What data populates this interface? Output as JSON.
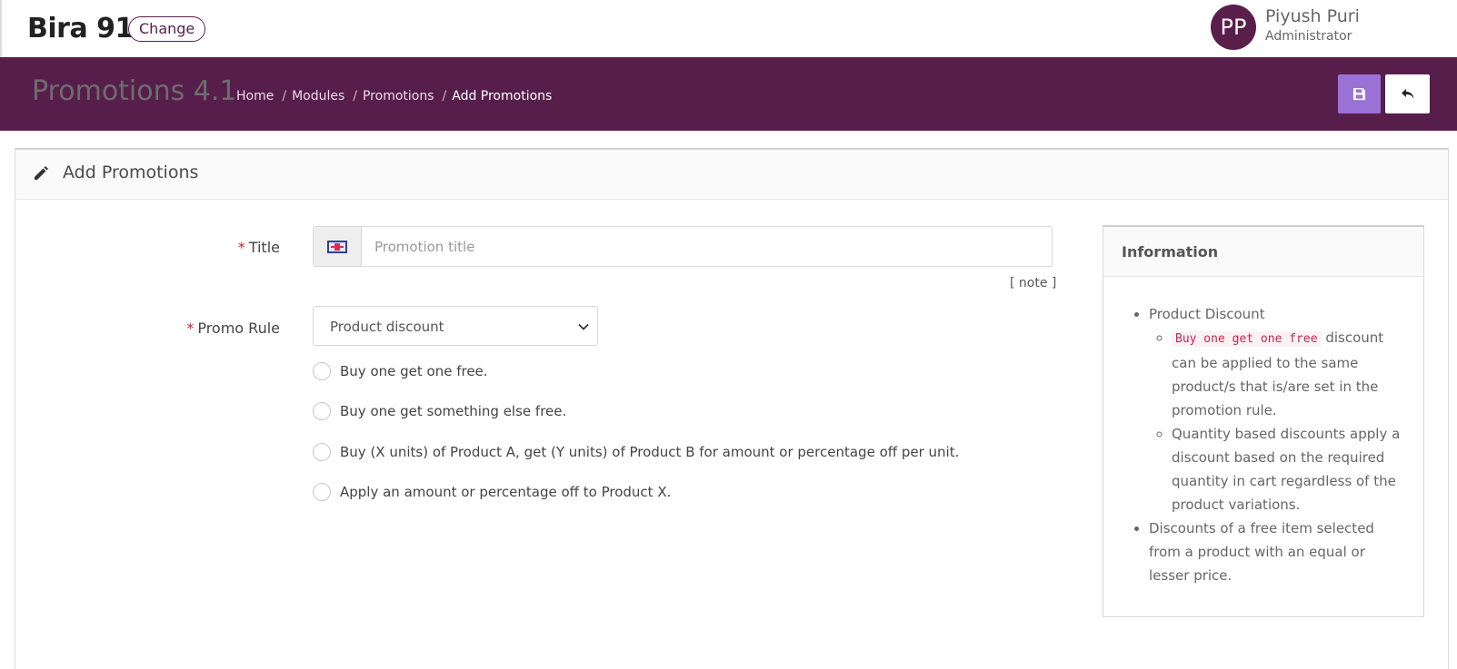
{
  "header": {
    "brand": "Bira 91",
    "change_label": "Change",
    "user": {
      "initials": "PP",
      "name": "Piyush Puri",
      "role": "Administrator"
    }
  },
  "band": {
    "heading": "Promotions 4.1",
    "breadcrumb": [
      {
        "label": "Home"
      },
      {
        "label": "Modules"
      },
      {
        "label": "Promotions"
      },
      {
        "label": "Add Promotions"
      }
    ],
    "save_icon": "save-icon",
    "back_icon": "undo-icon"
  },
  "form": {
    "card_title": "Add Promotions",
    "title_label": "Title",
    "title_placeholder": "Promotion title",
    "title_value": "",
    "note_link": "[ note ]",
    "promo_rule_label": "Promo Rule",
    "promo_rule_value": "Product discount",
    "required_mark": "*",
    "options": [
      {
        "label": "Buy one get one free."
      },
      {
        "label": "Buy one get something else free."
      },
      {
        "label": "Buy (X units) of Product A, get (Y units) of Product B for amount or percentage off per unit."
      },
      {
        "label": "Apply an amount or percentage off to Product X."
      }
    ]
  },
  "info": {
    "title": "Information",
    "item1": "Product Discount",
    "sub1_code": "Buy one get one free",
    "sub1_text": " discount can be applied to the same product/s that is/are set in the promotion rule.",
    "sub2_text": "Quantity based discounts apply a discount based on the required quantity in cart regardless of the product variations.",
    "item2": "Discounts of a free item selected from a product with an equal or lesser price."
  },
  "colors": {
    "band": "#581e4b",
    "save_button": "#9a72d6",
    "required": "#c62828"
  }
}
